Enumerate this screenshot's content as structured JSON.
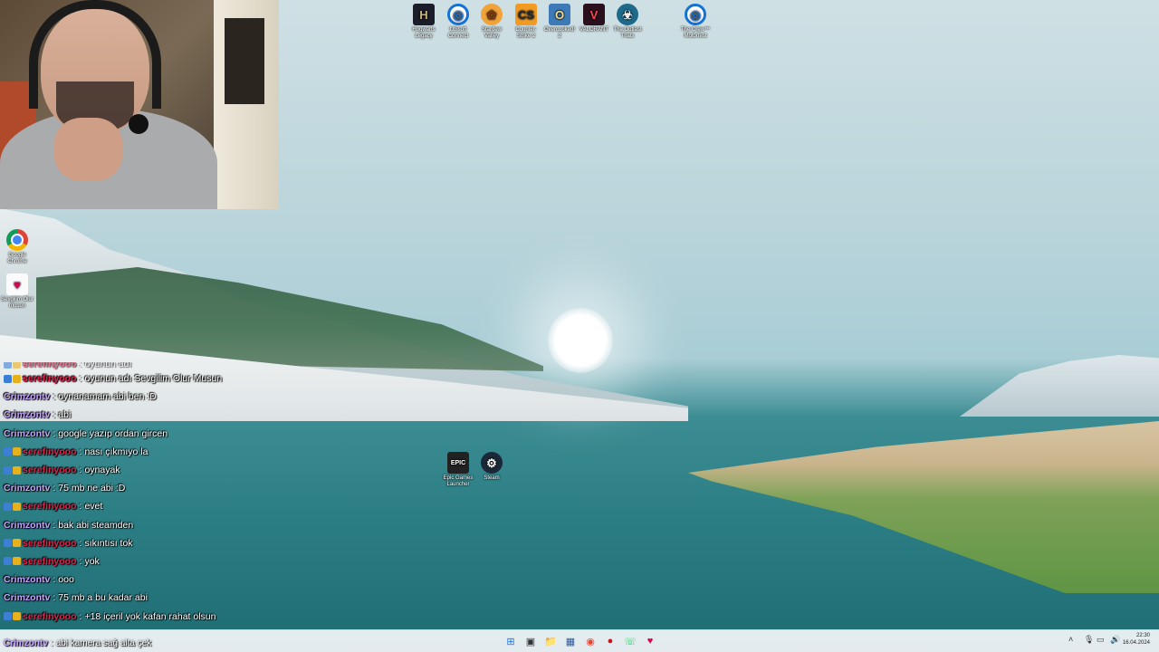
{
  "desktop_icons_top": [
    {
      "label": "Hogwarts Legacy",
      "glyph": "H",
      "icon": "hogwarts-icon"
    },
    {
      "label": "Ubisoft Connect",
      "glyph": "◎",
      "icon": "ubisoft-icon"
    },
    {
      "label": "Stardew Valley",
      "glyph": "✿",
      "icon": "stardew-icon"
    },
    {
      "label": "Counter-Strike 2",
      "glyph": "CS",
      "icon": "counter-strike-icon"
    },
    {
      "label": "Overcooked! 2",
      "glyph": "O",
      "icon": "overcooked-icon"
    },
    {
      "label": "VALORANT",
      "glyph": "V",
      "icon": "valorant-icon"
    },
    {
      "label": "The Outlast Trials",
      "glyph": "☣",
      "icon": "outlast-icon"
    },
    {
      "label": "The Crew™ Motorfest",
      "glyph": "◎",
      "icon": "ubisoft-icon"
    }
  ],
  "desktop_icons_left": [
    {
      "label": "Google Chrome",
      "glyph": "",
      "icon": "chrome-icon"
    },
    {
      "label": "Sevgilim Olur musun",
      "glyph": "♥",
      "icon": "sevgilim-icon"
    }
  ],
  "desktop_icons_middle": [
    {
      "label": "Epic Games Launcher",
      "glyph": "EPIC",
      "icon": "epic-games-icon"
    },
    {
      "label": "Steam",
      "glyph": "⚙",
      "icon": "steam-icon"
    }
  ],
  "chat": {
    "partial_top": "oyunun adı",
    "messages": [
      {
        "user": "serefinyooo",
        "text": "oyunun adı Sevgilim Olur Musun",
        "badges": true
      },
      {
        "user": "Crimzontv",
        "text": "oynanamam abi ben :D",
        "badges": false
      },
      {
        "user": "Crimzontv",
        "text": "abi",
        "badges": false
      },
      {
        "user": "Crimzontv",
        "text": "google yazıp ordan gircen",
        "badges": false
      },
      {
        "user": "serefinyooo",
        "text": "nası çıkmıyo la",
        "badges": true
      },
      {
        "user": "serefinyooo",
        "text": "oynayak",
        "badges": true
      },
      {
        "user": "Crimzontv",
        "text": "75 mb ne abi :D",
        "badges": false
      },
      {
        "user": "serefinyooo",
        "text": "evet",
        "badges": true
      },
      {
        "user": "Crimzontv",
        "text": "bak abi steamden",
        "badges": false
      },
      {
        "user": "serefinyooo",
        "text": "sıkıntısı tok",
        "badges": true
      },
      {
        "user": "serefinyooo",
        "text": "yok",
        "badges": true
      },
      {
        "user": "Crimzontv",
        "text": "ooo",
        "badges": false
      },
      {
        "user": "Crimzontv",
        "text": "75 mb a bu kadar abi",
        "badges": false
      },
      {
        "user": "serefinyooo",
        "text": "+18 içeril yok kafan rahat olsun",
        "badges": true
      }
    ],
    "bottom_overlay": {
      "user": "Crimzontv",
      "text": "abi kamera sağ alta çek"
    }
  },
  "taskbar": {
    "apps": [
      {
        "name": "start",
        "glyph": "⊞"
      },
      {
        "name": "task-view",
        "glyph": "▣"
      },
      {
        "name": "file-explorer",
        "glyph": "📁"
      },
      {
        "name": "store",
        "glyph": "▦"
      },
      {
        "name": "chrome",
        "glyph": "◉"
      },
      {
        "name": "app-red",
        "glyph": "●"
      },
      {
        "name": "whatsapp",
        "glyph": "☏"
      },
      {
        "name": "sevgilim",
        "glyph": "♥"
      }
    ],
    "clock_time": "22:30",
    "clock_date": "16.04.2024"
  },
  "colors": {
    "crimzon": "#c7a6ff",
    "serefin": "#e0244e"
  }
}
